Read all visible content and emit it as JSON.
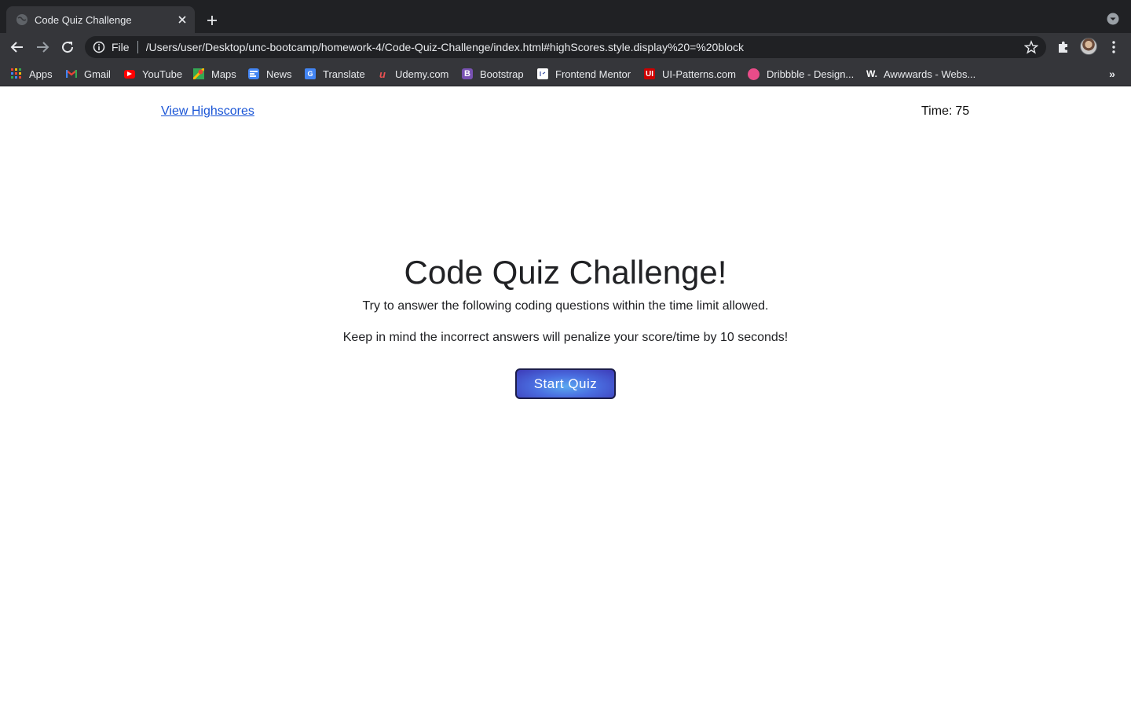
{
  "browser": {
    "tab": {
      "title": "Code Quiz Challenge"
    },
    "address_bar": {
      "scheme_label": "File",
      "url": "/Users/user/Desktop/unc-bootcamp/homework-4/Code-Quiz-Challenge/index.html#highScores.style.display%20=%20block"
    },
    "bookmarks": [
      {
        "label": "Apps",
        "icon": "apps-grid-icon",
        "color": "#ea4335"
      },
      {
        "label": "Gmail",
        "icon": "gmail-icon",
        "color": "#ea4335"
      },
      {
        "label": "YouTube",
        "icon": "youtube-icon",
        "color": "#ff0000"
      },
      {
        "label": "Maps",
        "icon": "maps-icon",
        "color": "#34a853"
      },
      {
        "label": "News",
        "icon": "news-icon",
        "color": "#4285f4"
      },
      {
        "label": "Translate",
        "icon": "translate-icon",
        "color": "#4285f4"
      },
      {
        "label": "Udemy.com",
        "icon": "udemy-icon",
        "color": "#ec5252"
      },
      {
        "label": "Bootstrap",
        "icon": "bootstrap-icon",
        "color": "#7952b3"
      },
      {
        "label": "Frontend Mentor",
        "icon": "frontend-mentor-icon",
        "color": "#ffffff"
      },
      {
        "label": "UI-Patterns.com",
        "icon": "ui-patterns-icon",
        "color": "#cc0000"
      },
      {
        "label": "Dribbble - Design...",
        "icon": "dribbble-icon",
        "color": "#ea4c89"
      },
      {
        "label": "Awwwards - Webs...",
        "icon": "awwwards-icon",
        "color": "#ffffff"
      }
    ]
  },
  "page": {
    "view_highscores": "View Highscores",
    "timer_label": "Time:",
    "timer_value": "75",
    "heading": "Code Quiz Challenge!",
    "instructions": "Try to answer the following coding questions within the time limit allowed.",
    "penalty_note": "Keep in mind the incorrect answers will penalize your score/time by 10 seconds!",
    "start_button": "Start Quiz"
  }
}
